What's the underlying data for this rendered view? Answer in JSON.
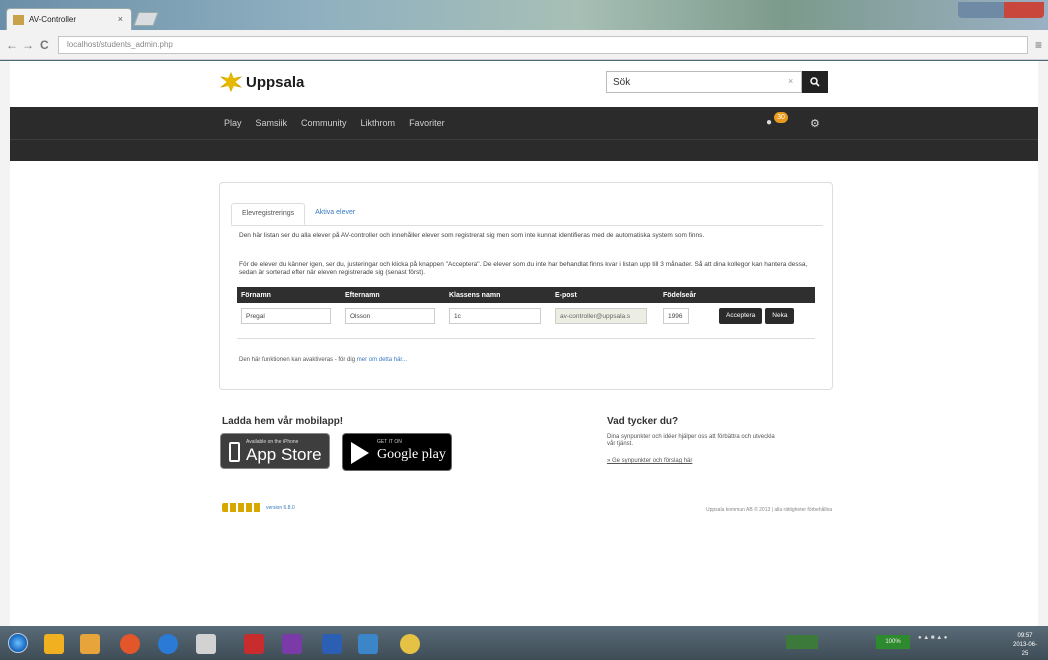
{
  "browser": {
    "tab_title": "AV-Controller",
    "tab_close": "×",
    "url": "localhost/students_admin.php",
    "back": "←",
    "forward": "→",
    "reload": "C",
    "menu": "≡"
  },
  "header": {
    "logo_text": "Uppsala",
    "search": {
      "value": "Sök",
      "clear": "×",
      "button_icon": "search-icon"
    }
  },
  "nav": {
    "items": [
      "Play",
      "Samsiik",
      "Community",
      "Likthrom",
      "Favoriter"
    ],
    "badge_count": "30"
  },
  "panel": {
    "tabs": [
      {
        "label": "Elevregistrerings",
        "active": true
      },
      {
        "label": "Aktiva elever",
        "active": false
      }
    ],
    "paragraph1": "Den här listan ser du alla elever på AV-controller och innehåller elever som registrerat sig men som inte kunnat identifieras med de automatiska system som finns.",
    "paragraph2": "För de elever du känner igen, ser du, justeringar och klicka på knappen \"Acceptera\". De elever som du inte har behandlat finns kvar i listan upp till 3 månader. Så att dina kollegor kan hantera dessa, sedan är sorterad efter när eleven registrerade sig (senast först).",
    "table": {
      "headers": [
        "Förnamn",
        "Efternamn",
        "Klassens namn",
        "E-post",
        "Födelseår",
        ""
      ],
      "rows": [
        {
          "first": "Pregal",
          "last": "Olsson",
          "class": "1c",
          "email": "av-controller@uppsala.s",
          "year": "1996",
          "accept": "Acceptera",
          "delete": "Neka"
        }
      ]
    },
    "footnote_prefix": "Den här funktionen kan avaktiveras - för dig",
    "footnote_link": "mer om detta här..."
  },
  "apps": {
    "heading": "Ladda hem vår mobilapp!",
    "appstore_small": "Available on the iPhone",
    "appstore_big": "App Store",
    "googleplay_small": "GET IT ON",
    "googleplay_big": "Google play"
  },
  "feedback": {
    "heading": "Vad tycker du?",
    "text": "Dina synpunkter och idéer hjälper oss att förbättra och utveckla vår tjänst.",
    "link": "» Ge synpunkter och förslag här"
  },
  "footer": {
    "version": "version 6.8.0",
    "right_text": "Uppsala kommun AB © 2013 | alla rättigheter förbehållna"
  },
  "taskbar": {
    "clock_time": "09:57",
    "clock_date": "2013-06-25",
    "battery": "100%"
  }
}
